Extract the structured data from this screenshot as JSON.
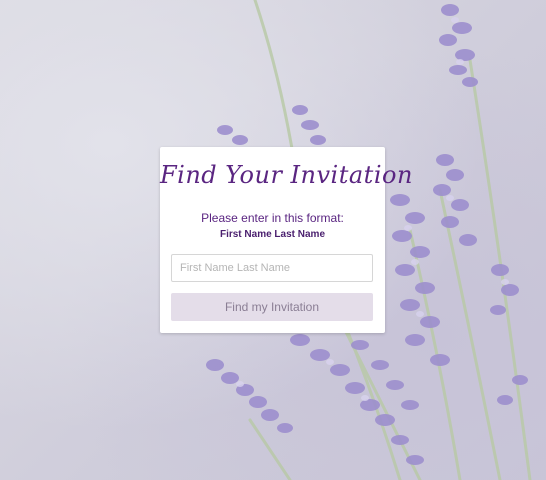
{
  "colors": {
    "accent": "#5a2581",
    "button_bg": "#e4dde9",
    "button_text": "#8a7e94",
    "card_bg": "#ffffff"
  },
  "background": {
    "image": "lavender-flowers-photo"
  },
  "card": {
    "title": "Find Your Invitation",
    "instruction": "Please enter in this format:",
    "format_example": "First Name Last Name",
    "name_input": {
      "value": "",
      "placeholder": "First Name Last Name"
    },
    "submit_label": "Find my Invitation"
  }
}
